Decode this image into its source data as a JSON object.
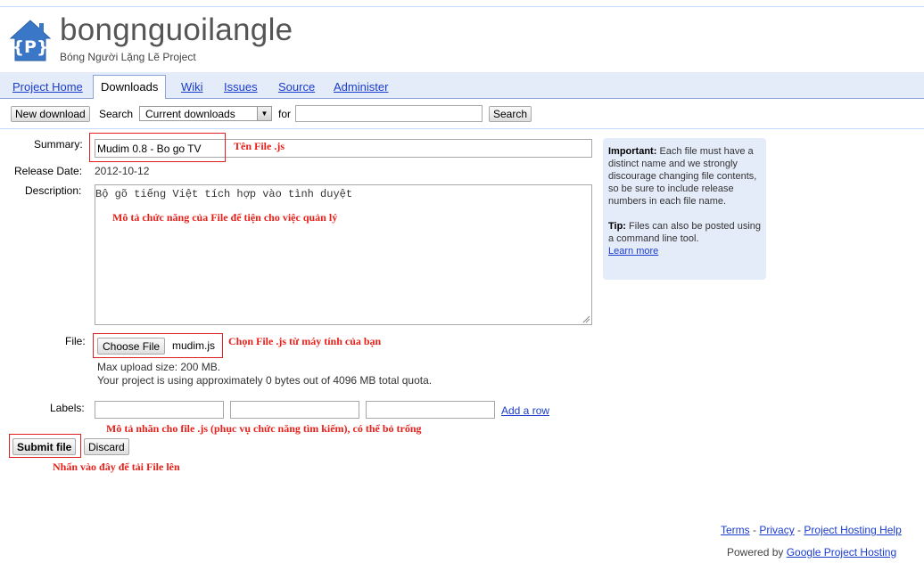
{
  "header": {
    "project_name": "bongnguoilangle",
    "project_subtitle": "Bóng Người Lặng Lẽ Project",
    "logo_letter": "{P}",
    "logo_color": "#3a77c7"
  },
  "tabs": [
    {
      "label": "Project Home"
    },
    {
      "label": "Downloads",
      "active": true
    },
    {
      "label": "Wiki"
    },
    {
      "label": "Issues"
    },
    {
      "label": "Source"
    },
    {
      "label": "Administer"
    }
  ],
  "toolbar": {
    "new_download_label": "New download",
    "search_label": "Search",
    "select_value": "Current downloads",
    "for_label": "for",
    "search_input_value": "",
    "search_button_label": "Search"
  },
  "form": {
    "summary_label": "Summary:",
    "summary_value": "Mudim 0.8 - Bo go TV",
    "release_date_label": "Release Date:",
    "release_date_value": "2012-10-12",
    "description_label": "Description:",
    "description_value": "Bộ gõ tiếng Việt tích hợp vào tình duyệt",
    "file_label": "File:",
    "choose_file_label": "Choose File",
    "file_name": "mudim.js",
    "max_upload": "Max upload size: 200 MB.",
    "quota": "Your project is using approximately 0 bytes out of 4096 MB total quota.",
    "labels_label": "Labels:",
    "labels_values": [
      "",
      "",
      ""
    ],
    "add_row_label": "Add a row",
    "submit_label": "Submit file",
    "discard_label": "Discard"
  },
  "annotations": {
    "summary_note": "Tên File .js",
    "description_note": "Mô tả chức năng của File để tiện cho việc quản lý",
    "file_note": "Chọn File .js từ máy tính của bạn",
    "labels_note": "Mô tả nhãn cho file .js (phục vụ chức năng tìm kiếm), có thể bỏ trống",
    "submit_note": "Nhấn vào đây để tải File lên",
    "annotation_color": "#e8201a"
  },
  "info_box": {
    "important_bold": "Important:",
    "important_text": " Each file must have a distinct name and we strongly discourage changing file contents, so be sure to include release numbers in each file name.",
    "tip_bold": "Tip:",
    "tip_text": " Files can also be posted using a command line tool.",
    "learn_more": "Learn more"
  },
  "footer": {
    "terms": "Terms",
    "privacy": "Privacy",
    "help": "Project Hosting Help",
    "separator": "-",
    "powered_by": "Powered by",
    "google_hosting": "Google Project Hosting"
  },
  "colors": {
    "tab_bar": "#e5ecf9",
    "link": "#1a3ccc",
    "info_box": "#e5ecf9"
  }
}
